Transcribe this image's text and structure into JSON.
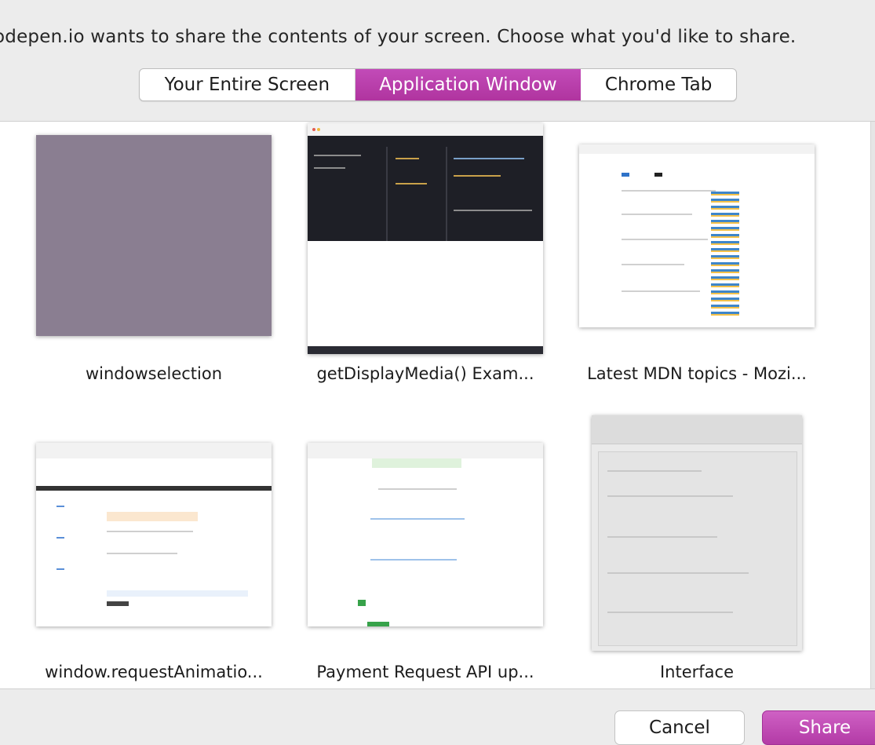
{
  "prompt": "odepen.io wants to share the contents of your screen. Choose what you'd like to share.",
  "tabs": [
    {
      "label": "Your Entire Screen",
      "selected": false
    },
    {
      "label": "Application Window",
      "selected": true
    },
    {
      "label": "Chrome Tab",
      "selected": false
    }
  ],
  "windows": [
    {
      "title": "windowselection"
    },
    {
      "title": "getDisplayMedia() Exam..."
    },
    {
      "title": "Latest MDN topics - Mozi..."
    },
    {
      "title": "window.requestAnimatio..."
    },
    {
      "title": "Payment Request API up..."
    },
    {
      "title": "Interface"
    }
  ],
  "buttons": {
    "cancel": "Cancel",
    "share": "Share"
  },
  "colors": {
    "accent": "#b83eab",
    "background": "#ececec",
    "panel": "#ffffff"
  }
}
